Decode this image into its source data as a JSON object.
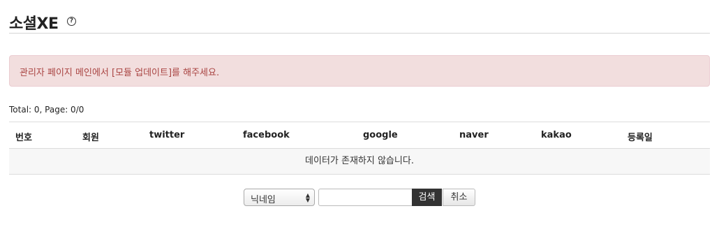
{
  "page": {
    "title": "소셜XE",
    "help_glyph": "?",
    "help_icon": "help-circle-icon"
  },
  "alert": {
    "message": "관리자 페이지 메인에서 [모듈 업데이트]를 해주세요."
  },
  "summary": "Total: 0, Page: 0/0",
  "table": {
    "headers": [
      "번호",
      "회원",
      "twitter",
      "facebook",
      "google",
      "naver",
      "kakao",
      "등록일"
    ],
    "empty_message": "데이터가 존재하지 않습니다."
  },
  "search": {
    "select_value": "닉네임",
    "input_value": "",
    "search_label": "검색",
    "cancel_label": "취소"
  },
  "colors": {
    "alert_bg": "#f2dede",
    "alert_text": "#a94442",
    "search_button_bg": "#333333"
  }
}
